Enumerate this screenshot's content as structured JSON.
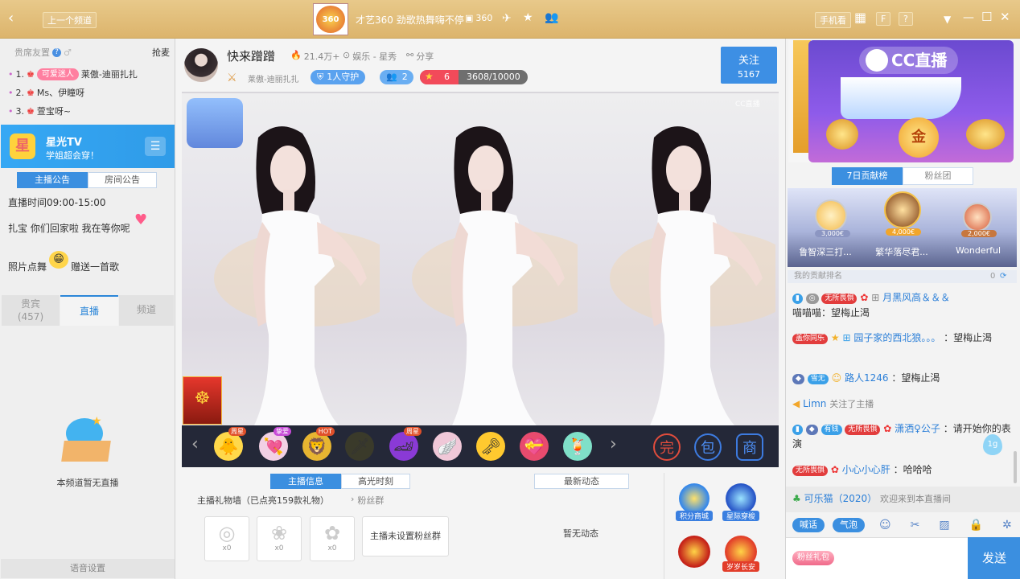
{
  "titlebar": {
    "prev_channel": "上一个频道",
    "logo_text": "360",
    "title": "才艺360 劲歌热舞嗨不停",
    "count": "360",
    "phone_label": "手机看",
    "f_label": "F",
    "help_label": "?"
  },
  "left": {
    "header_title": "贵席友置",
    "grab_label": "抢麦",
    "ranks": [
      {
        "num": "1.",
        "badge": "可爱迷人",
        "name": "莱傲-迪丽扎扎"
      },
      {
        "num": "2.",
        "name": "Ms、伊瞳呀"
      },
      {
        "num": "3.",
        "name": "萱宝呀~"
      }
    ],
    "banner_title": "星光TV",
    "banner_sub": "学姐超会穿！",
    "notice_tabs": [
      "主播公告",
      "房间公告"
    ],
    "notice_lines": [
      "直播时间09:00-15:00",
      "扎宝 你们回家啦 我在等你呢",
      "照片点舞",
      "赠送一首歌"
    ],
    "nav_tabs": [
      {
        "label": "贵宾",
        "sub": "(457)"
      },
      {
        "label": "直播",
        "sub": ""
      },
      {
        "label": "频道",
        "sub": ""
      }
    ],
    "empty_text": "本频道暂无直播",
    "voice_settings": "语音设置"
  },
  "center": {
    "anchor_name": "快来蹭蹭",
    "heat": "21.4万+",
    "category": "娱乐 - 星秀",
    "share": "分享",
    "agency": "莱傲-迪丽扎扎",
    "guard": "1人守护",
    "fans": "2",
    "level": "6",
    "exp": "3608/10000",
    "exp_progress": 0.3608,
    "follow_label": "关注",
    "follow_count": "5167",
    "watermark": "CC直播",
    "gift_tags": [
      "周星",
      "挚爱",
      "HOT",
      "",
      "周星"
    ],
    "info_tabs": [
      "主播信息",
      "高光时刻"
    ],
    "feed_tab": "最新动态",
    "gift_wall": "主播礼物墙（已点亮159款礼物）",
    "fan_group_link": "粉丝群",
    "gift_counts": [
      "x0",
      "x0",
      "x0"
    ],
    "no_fan_group": "主播未设置粉丝群",
    "no_feed": "暂无动态",
    "side_icons": [
      "积分商城",
      "星际穿梭",
      "",
      "岁岁长安"
    ]
  },
  "right": {
    "ad_logo": "CC直播",
    "ad_badge": "金",
    "rank_tabs": [
      "7日贡献榜",
      "粉丝团"
    ],
    "podium": [
      {
        "value": "3,000€",
        "name": "鲁智深三打..."
      },
      {
        "value": "4,000€",
        "name": "繁华落尽君..."
      },
      {
        "value": "2,000€",
        "name": "Wonderful"
      }
    ],
    "my_rank": "我的贡献排名",
    "my_rank_extra": "0",
    "chat": [
      {
        "tag": "无所畏惧",
        "name": "月黑风高＆＆＆",
        "msg": "喵喵喵：望梅止渴"
      },
      {
        "tag": "盖你同乐",
        "name": "园子家的西北狼。。。",
        "msg": "：望梅止渴"
      },
      {
        "tag": "雪无",
        "name": "路人1246",
        "msg": "：望梅止渴"
      },
      {
        "name": "Limn",
        "msg": "关注了主播"
      },
      {
        "tag": "有钱",
        "tag2": "无所畏惧",
        "name": "潇洒♀公子",
        "msg": "：请开始你的表演"
      },
      {
        "tag": "无所畏惧",
        "name": "小心小心肝",
        "msg": "：哈哈哈"
      },
      {
        "name": "可乐猫（2020）",
        "msg": "欢迎来到本直播间"
      }
    ],
    "float_badge": "1g",
    "chips": [
      "喊话",
      "气泡"
    ],
    "input_badge": "粉丝礼包",
    "send_label": "发送"
  }
}
